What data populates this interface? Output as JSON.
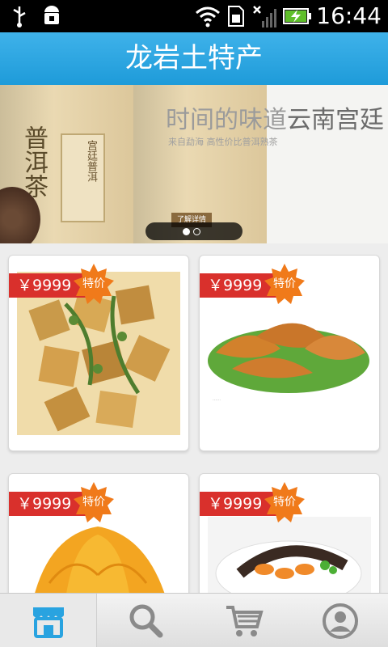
{
  "status_bar": {
    "time": "16:44",
    "icons": [
      "usb-icon",
      "android-debug-icon",
      "wifi-icon",
      "sim-icon",
      "no-signal-icon",
      "battery-charging-icon"
    ]
  },
  "header": {
    "title": "龙岩土特产"
  },
  "banner": {
    "headline_light": "时间的味道",
    "headline_bold": "云南宫廷",
    "subline": "来自勐海  高性价比普洱熟茶",
    "box_label": "普洱茶",
    "box_inner_label": "宫廷普洱",
    "more_button": "了解详情",
    "pages": 2,
    "current_page": 1
  },
  "products": [
    {
      "price": "￥9999",
      "badge": "特价",
      "image": "dried-tofu"
    },
    {
      "price": "￥9999",
      "badge": "特价",
      "image": "braised-duck-feet"
    },
    {
      "price": "￥9999",
      "badge": "特价",
      "image": "dried-persimmon"
    },
    {
      "price": "￥9999",
      "badge": "特价",
      "image": "cured-duck-platter"
    }
  ],
  "bottom_nav": {
    "items": [
      {
        "name": "store",
        "icon": "store-icon",
        "active": true
      },
      {
        "name": "search",
        "icon": "search-icon",
        "active": false
      },
      {
        "name": "cart",
        "icon": "cart-icon",
        "active": false
      },
      {
        "name": "profile",
        "icon": "user-icon",
        "active": false
      }
    ]
  },
  "colors": {
    "header_blue": "#1e9bd9",
    "price_red": "#d9302c",
    "badge_orange": "#f07a1a",
    "nav_icon_gray": "#8a8a8a",
    "nav_icon_active": "#29a3e0"
  }
}
